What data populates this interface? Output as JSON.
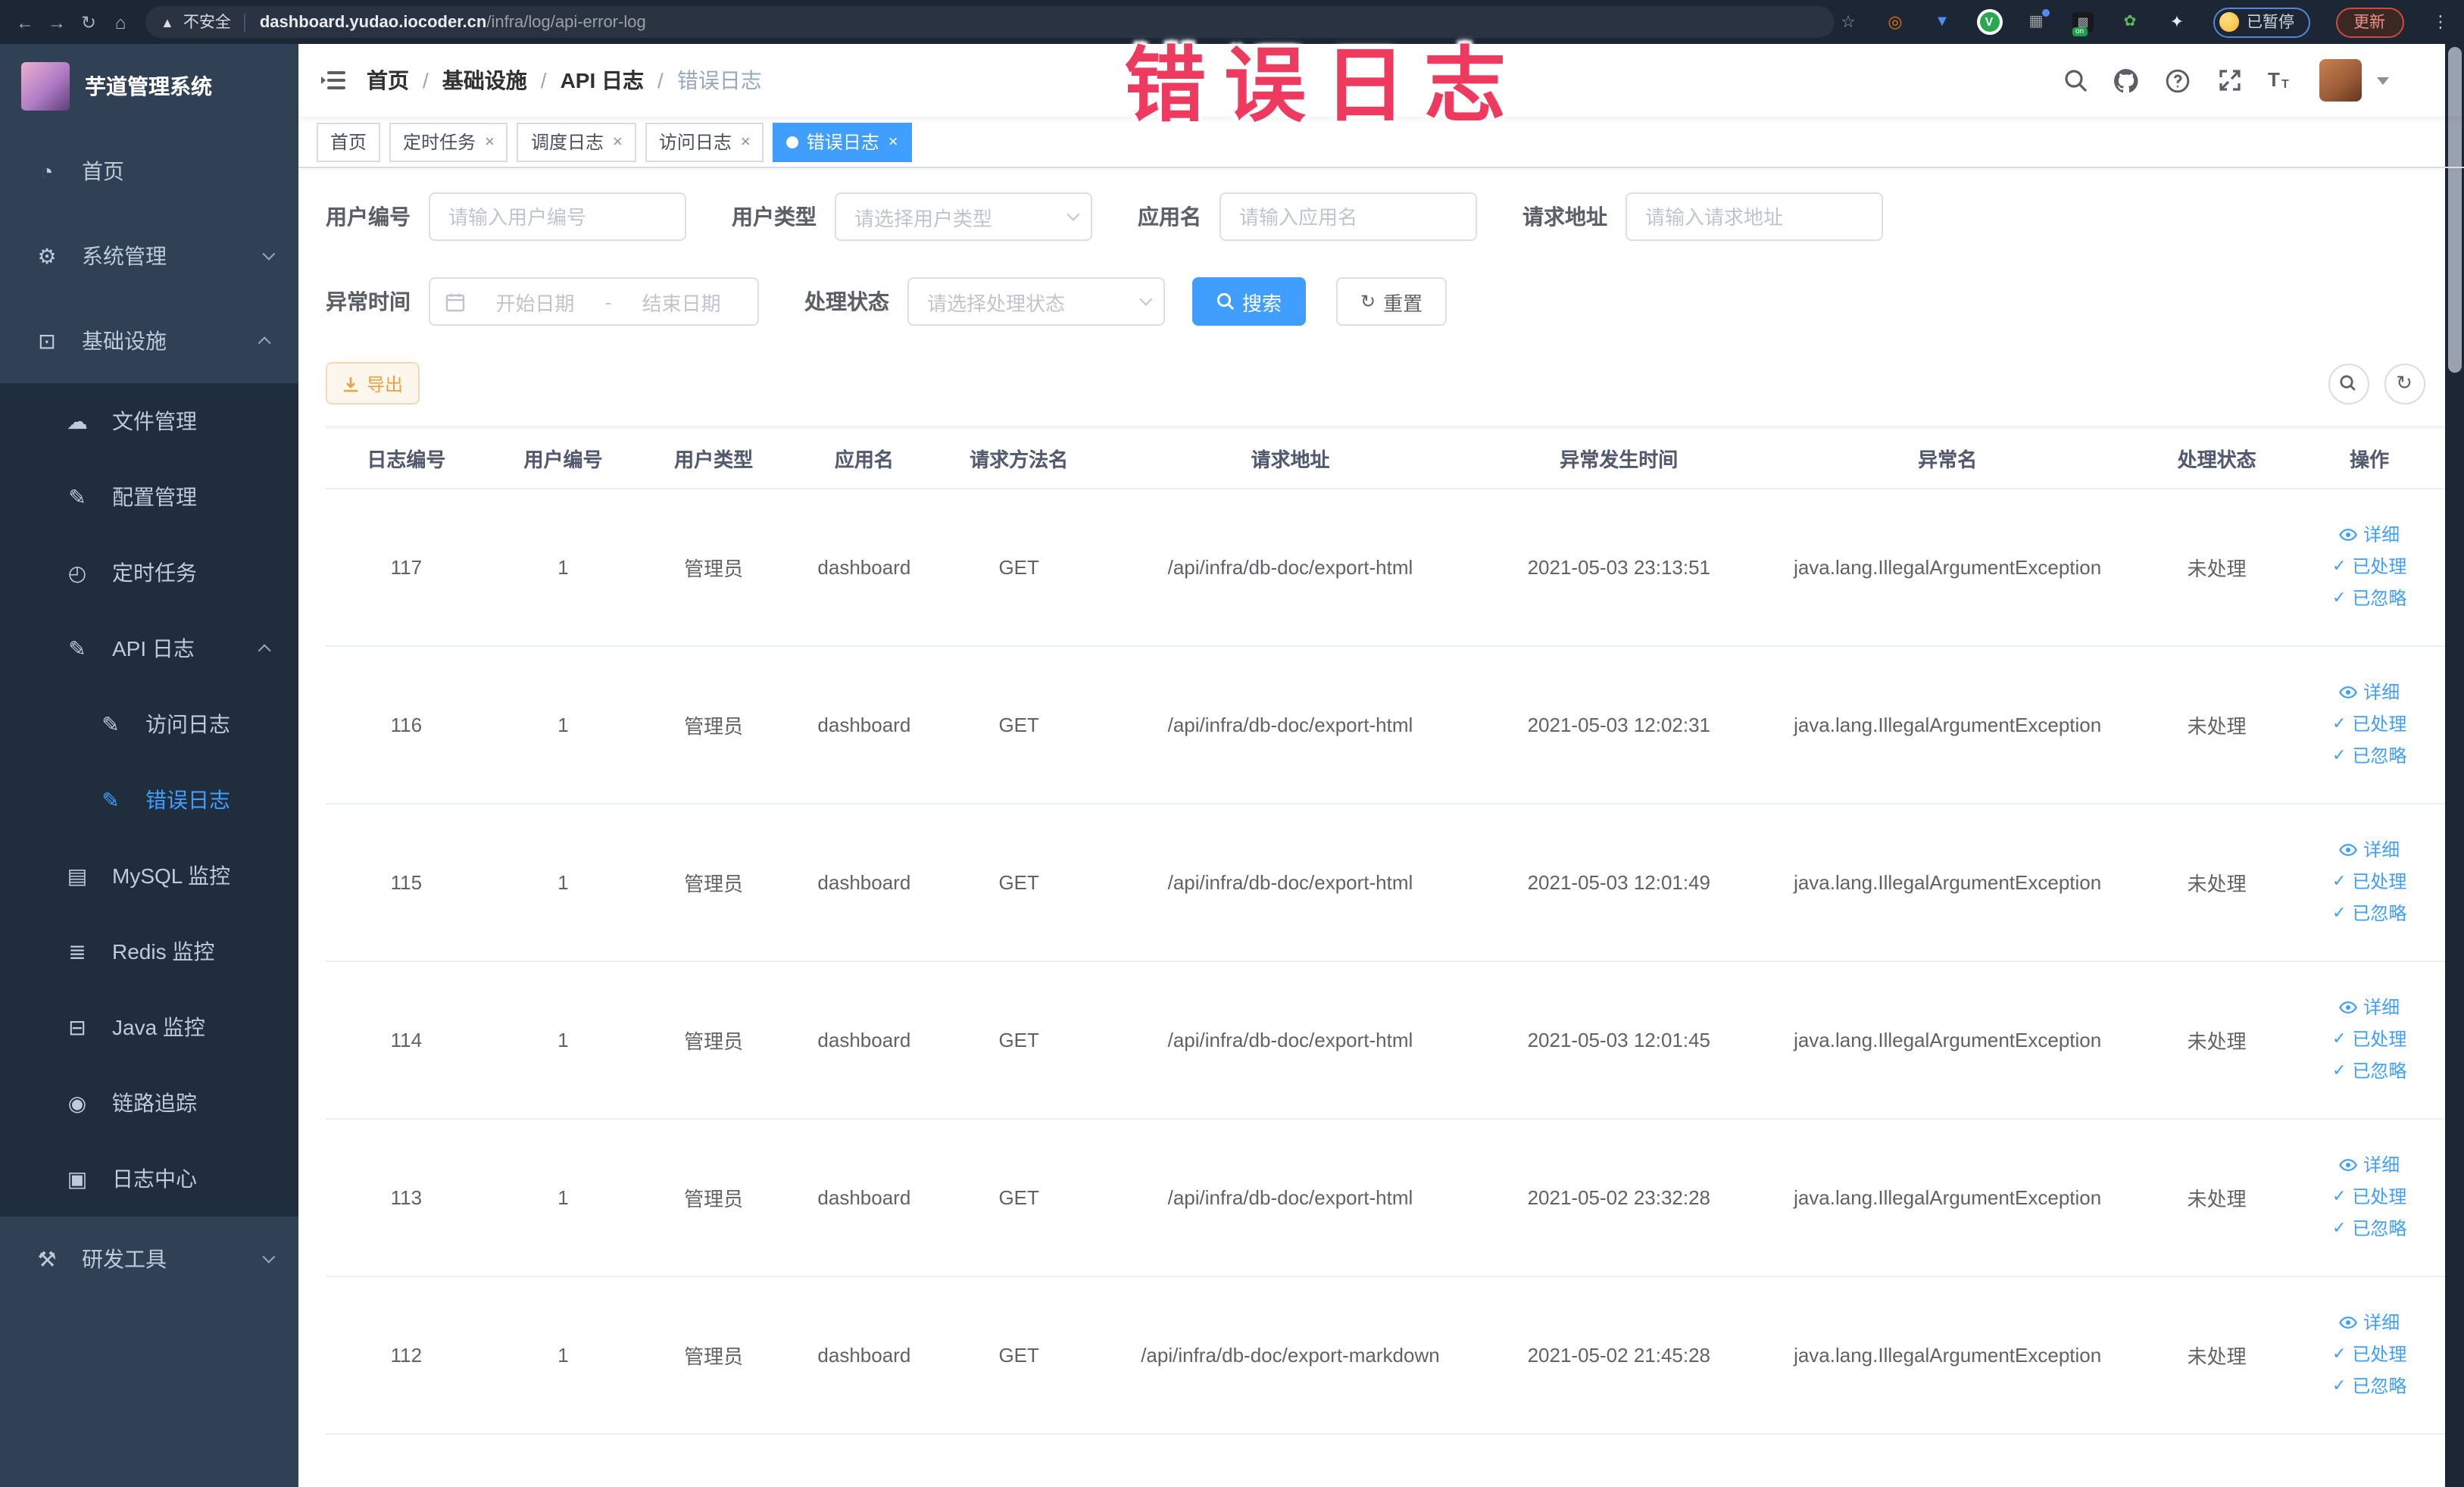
{
  "watermark_text": "错误日志",
  "browser": {
    "security_label": "不安全",
    "url_domain": "dashboard.yudao.iocoder.cn",
    "url_path": "/infra/log/api-error-log",
    "profile_paused_label": "已暂停",
    "update_label": "更新"
  },
  "sidebar": {
    "app_title": "芋道管理系统",
    "menu": {
      "home": "首页",
      "system": "系统管理",
      "infra": "基础设施",
      "file": "文件管理",
      "config": "配置管理",
      "job": "定时任务",
      "api_log": "API 日志",
      "access_log": "访问日志",
      "error_log": "错误日志",
      "mysql": "MySQL 监控",
      "redis": "Redis 监控",
      "java": "Java 监控",
      "trace": "链路追踪",
      "log_center": "日志中心",
      "dev_tools": "研发工具"
    }
  },
  "navbar": {
    "breadcrumb": [
      "首页",
      "基础设施",
      "API 日志",
      "错误日志"
    ],
    "separator": "/"
  },
  "tabs": [
    {
      "label": "首页"
    },
    {
      "label": "定时任务"
    },
    {
      "label": "调度日志"
    },
    {
      "label": "访问日志"
    },
    {
      "label": "错误日志"
    }
  ],
  "filters": {
    "user_id": {
      "label": "用户编号",
      "placeholder": "请输入用户编号"
    },
    "user_type": {
      "label": "用户类型",
      "placeholder": "请选择用户类型"
    },
    "app_name": {
      "label": "应用名",
      "placeholder": "请输入应用名"
    },
    "request_url": {
      "label": "请求地址",
      "placeholder": "请输入请求地址"
    },
    "exception_time": {
      "label": "异常时间",
      "start_placeholder": "开始日期",
      "separator": "-",
      "end_placeholder": "结束日期"
    },
    "process_status": {
      "label": "处理状态",
      "placeholder": "请选择处理状态"
    },
    "search_label": "搜索",
    "reset_label": "重置"
  },
  "toolbar": {
    "export_label": "导出"
  },
  "table": {
    "headers": [
      "日志编号",
      "用户编号",
      "用户类型",
      "应用名",
      "请求方法名",
      "请求地址",
      "异常发生时间",
      "异常名",
      "处理状态",
      "操作"
    ],
    "actions": [
      "详细",
      "已处理",
      "已忽略"
    ],
    "rows": [
      {
        "log_id": "117",
        "user_id": "1",
        "user_type": "管理员",
        "app_name": "dashboard",
        "method": "GET",
        "request_url": "/api/infra/db-doc/export-html",
        "time": "2021-05-03 23:13:51",
        "exception": "java.lang.IllegalArgumentException",
        "status": "未处理"
      },
      {
        "log_id": "116",
        "user_id": "1",
        "user_type": "管理员",
        "app_name": "dashboard",
        "method": "GET",
        "request_url": "/api/infra/db-doc/export-html",
        "time": "2021-05-03 12:02:31",
        "exception": "java.lang.IllegalArgumentException",
        "status": "未处理"
      },
      {
        "log_id": "115",
        "user_id": "1",
        "user_type": "管理员",
        "app_name": "dashboard",
        "method": "GET",
        "request_url": "/api/infra/db-doc/export-html",
        "time": "2021-05-03 12:01:49",
        "exception": "java.lang.IllegalArgumentException",
        "status": "未处理"
      },
      {
        "log_id": "114",
        "user_id": "1",
        "user_type": "管理员",
        "app_name": "dashboard",
        "method": "GET",
        "request_url": "/api/infra/db-doc/export-html",
        "time": "2021-05-03 12:01:45",
        "exception": "java.lang.IllegalArgumentException",
        "status": "未处理"
      },
      {
        "log_id": "113",
        "user_id": "1",
        "user_type": "管理员",
        "app_name": "dashboard",
        "method": "GET",
        "request_url": "/api/infra/db-doc/export-html",
        "time": "2021-05-02 23:32:28",
        "exception": "java.lang.IllegalArgumentException",
        "status": "未处理"
      },
      {
        "log_id": "112",
        "user_id": "1",
        "user_type": "管理员",
        "app_name": "dashboard",
        "method": "GET",
        "request_url": "/api/infra/db-doc/export-markdown",
        "time": "2021-05-02 21:45:28",
        "exception": "java.lang.IllegalArgumentException",
        "status": "未处理"
      }
    ]
  }
}
